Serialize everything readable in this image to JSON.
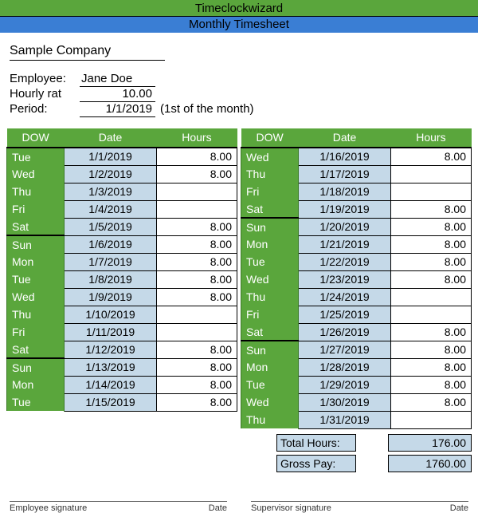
{
  "header": {
    "title": "Timeclockwizard",
    "subtitle": "Monthly Timesheet"
  },
  "company": "Sample Company",
  "meta": {
    "employee_label": "Employee:",
    "employee": "Jane Doe",
    "rate_label": "Hourly rat",
    "rate": "10.00",
    "period_label": "Period:",
    "period": "1/1/2019",
    "period_note": "(1st of the month)"
  },
  "columns": {
    "dow": "DOW",
    "date": "Date",
    "hours": "Hours"
  },
  "rows_left": [
    {
      "dow": "Tue",
      "date": "1/1/2019",
      "hours": "8.00"
    },
    {
      "dow": "Wed",
      "date": "1/2/2019",
      "hours": "8.00"
    },
    {
      "dow": "Thu",
      "date": "1/3/2019",
      "hours": ""
    },
    {
      "dow": "Fri",
      "date": "1/4/2019",
      "hours": ""
    },
    {
      "dow": "Sat",
      "date": "1/5/2019",
      "hours": "8.00",
      "week_end": true
    },
    {
      "dow": "Sun",
      "date": "1/6/2019",
      "hours": "8.00"
    },
    {
      "dow": "Mon",
      "date": "1/7/2019",
      "hours": "8.00"
    },
    {
      "dow": "Tue",
      "date": "1/8/2019",
      "hours": "8.00"
    },
    {
      "dow": "Wed",
      "date": "1/9/2019",
      "hours": "8.00"
    },
    {
      "dow": "Thu",
      "date": "1/10/2019",
      "hours": ""
    },
    {
      "dow": "Fri",
      "date": "1/11/2019",
      "hours": ""
    },
    {
      "dow": "Sat",
      "date": "1/12/2019",
      "hours": "8.00",
      "week_end": true
    },
    {
      "dow": "Sun",
      "date": "1/13/2019",
      "hours": "8.00"
    },
    {
      "dow": "Mon",
      "date": "1/14/2019",
      "hours": "8.00"
    },
    {
      "dow": "Tue",
      "date": "1/15/2019",
      "hours": "8.00"
    }
  ],
  "rows_right": [
    {
      "dow": "Wed",
      "date": "1/16/2019",
      "hours": "8.00"
    },
    {
      "dow": "Thu",
      "date": "1/17/2019",
      "hours": ""
    },
    {
      "dow": "Fri",
      "date": "1/18/2019",
      "hours": ""
    },
    {
      "dow": "Sat",
      "date": "1/19/2019",
      "hours": "8.00",
      "week_end": true
    },
    {
      "dow": "Sun",
      "date": "1/20/2019",
      "hours": "8.00"
    },
    {
      "dow": "Mon",
      "date": "1/21/2019",
      "hours": "8.00"
    },
    {
      "dow": "Tue",
      "date": "1/22/2019",
      "hours": "8.00"
    },
    {
      "dow": "Wed",
      "date": "1/23/2019",
      "hours": "8.00"
    },
    {
      "dow": "Thu",
      "date": "1/24/2019",
      "hours": ""
    },
    {
      "dow": "Fri",
      "date": "1/25/2019",
      "hours": ""
    },
    {
      "dow": "Sat",
      "date": "1/26/2019",
      "hours": "8.00",
      "week_end": true
    },
    {
      "dow": "Sun",
      "date": "1/27/2019",
      "hours": "8.00"
    },
    {
      "dow": "Mon",
      "date": "1/28/2019",
      "hours": "8.00"
    },
    {
      "dow": "Tue",
      "date": "1/29/2019",
      "hours": "8.00"
    },
    {
      "dow": "Wed",
      "date": "1/30/2019",
      "hours": "8.00"
    },
    {
      "dow": "Thu",
      "date": "1/31/2019",
      "hours": ""
    }
  ],
  "totals": {
    "hours_label": "Total Hours:",
    "hours_value": "176.00",
    "gross_label": "Gross Pay:",
    "gross_value": "1760.00"
  },
  "signatures": {
    "emp": "Employee signature",
    "sup": "Supervisor signature",
    "date": "Date"
  }
}
